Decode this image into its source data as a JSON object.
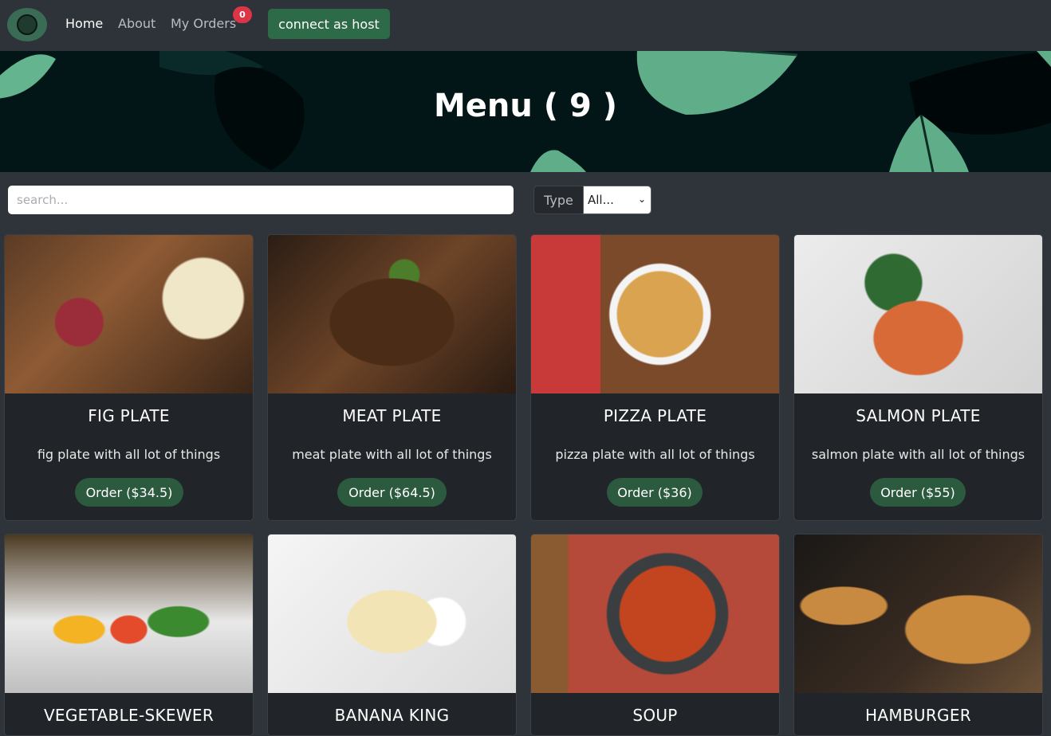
{
  "nav": {
    "links": [
      {
        "label": "Home",
        "active": true
      },
      {
        "label": "About",
        "active": false
      },
      {
        "label": "My Orders",
        "active": false
      }
    ],
    "orders_count": "0",
    "host_button": "connect as host"
  },
  "hero": {
    "title": "Menu ( 9 )"
  },
  "filters": {
    "search_placeholder": "search...",
    "type_label": "Type",
    "type_selected": "All..."
  },
  "menu": {
    "items": [
      {
        "title": "FIG PLATE",
        "description": "fig plate with all lot of things",
        "order_label": "Order ($34.5)"
      },
      {
        "title": "MEAT PLATE",
        "description": "meat plate with all lot of things",
        "order_label": "Order ($64.5)"
      },
      {
        "title": "PIZZA PLATE",
        "description": "pizza plate with all lot of things",
        "order_label": "Order ($36)"
      },
      {
        "title": "SALMON PLATE",
        "description": "salmon plate with all lot of things",
        "order_label": "Order ($55)"
      },
      {
        "title": "VEGETABLE-SKEWER"
      },
      {
        "title": "BANANA KING"
      },
      {
        "title": "SOUP"
      },
      {
        "title": "HAMBURGER"
      }
    ]
  },
  "colors": {
    "navbar": "#2e3339",
    "page_bg": "#2f343b",
    "card_bg": "#212529",
    "host_button": "#2d6a47",
    "order_button": "#2c5a3f",
    "badge": "#dc3545"
  }
}
